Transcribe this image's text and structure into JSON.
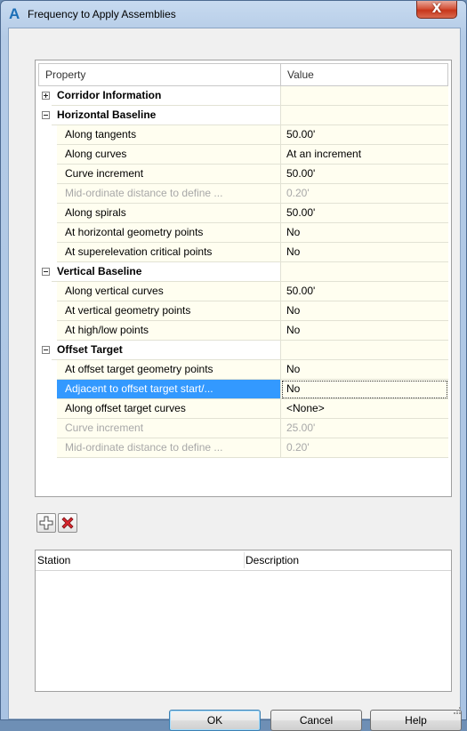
{
  "window": {
    "title": "Frequency to Apply Assemblies",
    "close_glyph": "X",
    "app_icon": "A"
  },
  "grid": {
    "columns": [
      "Property",
      "Value"
    ],
    "rows": [
      {
        "label": "Corridor Information",
        "value": "",
        "type": "category",
        "expanded": false
      },
      {
        "label": "Horizontal Baseline",
        "value": "",
        "type": "category",
        "expanded": true
      },
      {
        "label": "Along tangents",
        "value": "50.00'",
        "type": "item"
      },
      {
        "label": "Along curves",
        "value": "At an increment",
        "type": "item"
      },
      {
        "label": "Curve increment",
        "value": "50.00'",
        "type": "item"
      },
      {
        "label": "Mid-ordinate distance to define ...",
        "value": "0.20'",
        "type": "item",
        "disabled": true
      },
      {
        "label": "Along spirals",
        "value": "50.00'",
        "type": "item"
      },
      {
        "label": "At horizontal geometry points",
        "value": "No",
        "type": "item"
      },
      {
        "label": "At superelevation critical points",
        "value": "No",
        "type": "item"
      },
      {
        "label": "Vertical Baseline",
        "value": "",
        "type": "category",
        "expanded": true
      },
      {
        "label": "Along vertical curves",
        "value": "50.00'",
        "type": "item"
      },
      {
        "label": "At vertical geometry points",
        "value": "No",
        "type": "item"
      },
      {
        "label": "At high/low points",
        "value": "No",
        "type": "item"
      },
      {
        "label": "Offset Target",
        "value": "",
        "type": "category",
        "expanded": true
      },
      {
        "label": "At offset target geometry points",
        "value": "No",
        "type": "item"
      },
      {
        "label": "Adjacent to offset target start/...",
        "value": "No",
        "type": "item",
        "selected": true
      },
      {
        "label": "Along offset target curves",
        "value": "<None>",
        "type": "item"
      },
      {
        "label": "Curve increment",
        "value": "25.00'",
        "type": "item",
        "disabled": true
      },
      {
        "label": "Mid-ordinate distance to define ...",
        "value": "0.20'",
        "type": "item",
        "disabled": true
      }
    ]
  },
  "toolbar": {
    "add_icon": "add-icon",
    "delete_icon": "delete-icon"
  },
  "stations": {
    "columns": [
      "Station",
      "Description"
    ]
  },
  "buttons": {
    "ok": "OK",
    "cancel": "Cancel",
    "help": "Help"
  },
  "colors": {
    "selection": "#3399ff",
    "value_bg": "#fffef0",
    "delete_red": "#d9272e"
  }
}
